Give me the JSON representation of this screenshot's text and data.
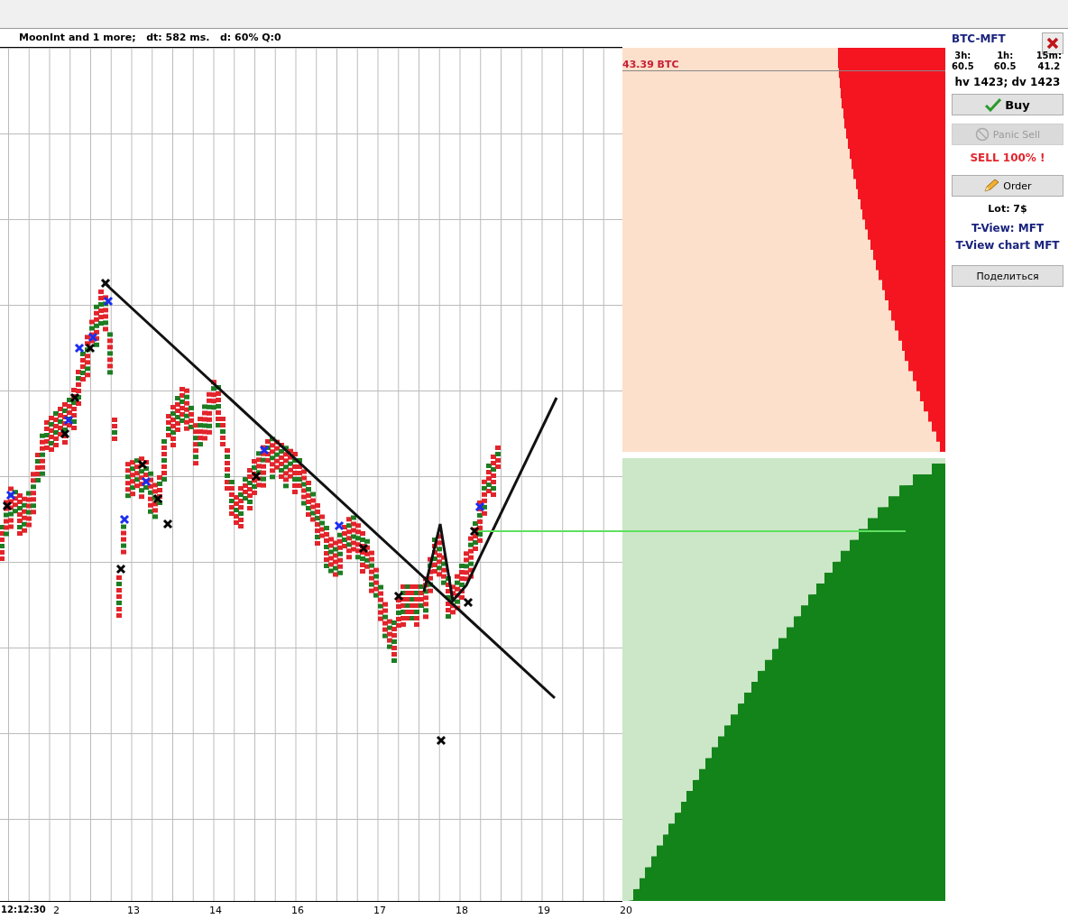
{
  "header": {
    "text": "MoonInt and 1 more;   dt: 582 ms.   d: 60% Q:0"
  },
  "x_axis": {
    "labels": [
      "12:12:30",
      "2",
      "13",
      "14",
      "16",
      "17",
      "18",
      "19",
      "20"
    ]
  },
  "order_book": {
    "ask_label": "43.39 BTC"
  },
  "panel": {
    "pair": "BTC-MFT",
    "stats": [
      {
        "label": "3h:",
        "value": "60.5"
      },
      {
        "label": "1h:",
        "value": "60.5"
      },
      {
        "label": "15m:",
        "value": "41.2"
      }
    ],
    "volumes": "hv 1423; dv 1423",
    "controls": [
      {
        "kind": "buy",
        "label": "Buy",
        "disabled": false
      },
      {
        "kind": "panic_sell",
        "label": "Panic Sell",
        "disabled": true
      },
      {
        "kind": "warning",
        "text": "SELL 100% !"
      },
      {
        "kind": "order",
        "label": "Order",
        "disabled": false
      },
      {
        "kind": "lot",
        "text": "Lot: 7$"
      },
      {
        "kind": "link",
        "text": "T-View: MFT"
      },
      {
        "kind": "link",
        "text": "T-View chart MFT"
      },
      {
        "kind": "share",
        "label": "Поделиться",
        "disabled": false
      }
    ]
  }
}
